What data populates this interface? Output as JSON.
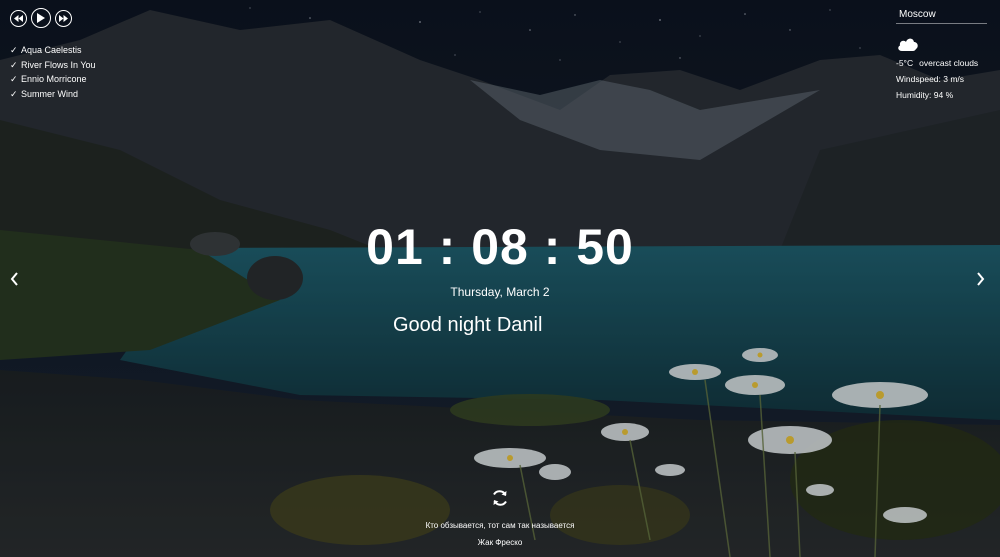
{
  "player": {
    "prev_icon": "skip-back-icon",
    "play_icon": "play-icon",
    "next_icon": "skip-forward-icon",
    "playlist": [
      {
        "title": "Aqua Caelestis"
      },
      {
        "title": "River Flows In You"
      },
      {
        "title": "Ennio Morricone"
      },
      {
        "title": "Summer Wind"
      }
    ]
  },
  "weather": {
    "city": "Moscow",
    "icon": "cloud-icon",
    "temperature": "-5°C",
    "description": "overcast clouds",
    "wind": "Windspeed: 3 m/s",
    "humidity": "Humidity: 94 %"
  },
  "clock": {
    "time": "01 : 08 : 50",
    "date": "Thursday, March 2"
  },
  "greeting": {
    "text": "Good night",
    "name": "Danil"
  },
  "quote": {
    "text": "Кто обзывается, тот сам так называется",
    "author": "Жак Фреско"
  },
  "colors": {
    "sky": "#111a2e",
    "lake": "#1c5868",
    "text": "#ffffff"
  }
}
